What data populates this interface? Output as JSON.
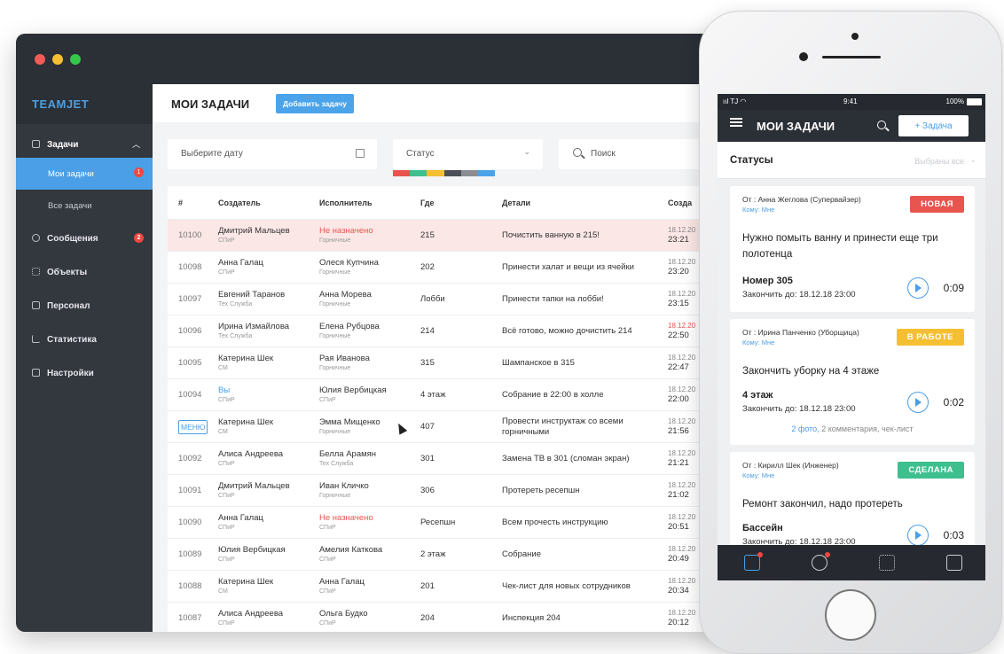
{
  "app": {
    "brand": "TEAMJET"
  },
  "sidebar": {
    "group": {
      "label": "Задачи",
      "icon": "tasks-icon"
    },
    "subitems": [
      {
        "label": "Мои задачи",
        "badge": "1"
      },
      {
        "label": "Все задачи"
      }
    ],
    "items": [
      {
        "label": "Сообщения",
        "icon": "messages-icon",
        "badge": "2"
      },
      {
        "label": "Объекты",
        "icon": "objects-icon"
      },
      {
        "label": "Персонал",
        "icon": "staff-icon"
      },
      {
        "label": "Статистика",
        "icon": "stats-icon"
      },
      {
        "label": "Настройки",
        "icon": "settings-icon"
      }
    ]
  },
  "header": {
    "title": "МОИ ЗАДАЧИ",
    "add_button": "Добавить задачу"
  },
  "filters": {
    "date_placeholder": "Выберите дату",
    "status_label": "Статус",
    "search_placeholder": "Поиск",
    "status_colors": [
      "#e8554e",
      "#3dbf8e",
      "#f5bf33",
      "#4b4f57",
      "#8a8d93",
      "#4ba3ea"
    ]
  },
  "table": {
    "columns": [
      "#",
      "Создатель",
      "Исполнитель",
      "Где",
      "Детали",
      "Созда"
    ],
    "rows": [
      {
        "id": "10100",
        "creator": "Дмитрий Мальцев",
        "creator_role": "СПиР",
        "assignee": "Не назначено",
        "assignee_role": "Горничные",
        "where": "215",
        "details": "Почистить ванную в 215!",
        "date": "18.12.20",
        "time": "23:21"
      },
      {
        "id": "10098",
        "creator": "Анна Галац",
        "creator_role": "СПиР",
        "assignee": "Олеся Купчина",
        "assignee_role": "Горничные",
        "where": "202",
        "details": "Принести халат и вещи из ячейки",
        "date": "18.12.20",
        "time": "23:20"
      },
      {
        "id": "10097",
        "creator": "Евгений Таранов",
        "creator_role": "Тех Служба",
        "assignee": "Анна Морева",
        "assignee_role": "Горничные",
        "where": "Лобби",
        "details": "Принести тапки на лобби!",
        "date": "18.12.20",
        "time": "23:15"
      },
      {
        "id": "10096",
        "creator": "Ирина Измайлова",
        "creator_role": "Тех Служба",
        "assignee": "Елена Рубцова",
        "assignee_role": "Горничные",
        "where": "214",
        "details": "Всё готово, можно дочистить 214",
        "date": "18.12.20",
        "time": "22:50"
      },
      {
        "id": "10095",
        "creator": "Катерина Шек",
        "creator_role": "СМ",
        "assignee": "Рая Иванова",
        "assignee_role": "Горничные",
        "where": "315",
        "details": "Шампанское в 315",
        "date": "18.12.20",
        "time": "22:47"
      },
      {
        "id": "10094",
        "creator": "Вы",
        "creator_role": "СПиР",
        "assignee": "Юлия Вербицкая",
        "assignee_role": "СПиР",
        "where": "4 этаж",
        "details": "Собрание в 22:00 в холле",
        "date": "18.12.20",
        "time": "22:00"
      },
      {
        "id": "МЕНЮ",
        "creator": "Катерина Шек",
        "creator_role": "СМ",
        "assignee": "Эмма Мищенко",
        "assignee_role": "Горничные",
        "where": "407",
        "details": "Провести инструктаж со всеми горничными",
        "date": "18.12.20",
        "time": "21:56"
      },
      {
        "id": "10092",
        "creator": "Алиса Андреева",
        "creator_role": "СПиР",
        "assignee": "Белла Арамян",
        "assignee_role": "Тех Служба",
        "where": "301",
        "details": "Замена ТВ в 301 (сломан экран)",
        "date": "18.12.20",
        "time": "21:21"
      },
      {
        "id": "10091",
        "creator": "Дмитрий Мальцев",
        "creator_role": "СПиР",
        "assignee": "Иван Кличко",
        "assignee_role": "Горничные",
        "where": "306",
        "details": "Протереть ресепшн",
        "date": "18.12.20",
        "time": "21:02"
      },
      {
        "id": "10090",
        "creator": "Анна Галац",
        "creator_role": "СПиР",
        "assignee": "Не назначено",
        "assignee_role": "СПиР",
        "where": "Ресепшн",
        "details": "Всем прочесть инструкцию",
        "date": "18.12.20",
        "time": "20:51"
      },
      {
        "id": "10089",
        "creator": "Юлия Вербицкая",
        "creator_role": "СПиР",
        "assignee": "Амелия Каткова",
        "assignee_role": "СПиР",
        "where": "2 этаж",
        "details": "Собрание",
        "date": "18.12.20",
        "time": "20:49"
      },
      {
        "id": "10088",
        "creator": "Катерина Шек",
        "creator_role": "СМ",
        "assignee": "Анна Галац",
        "assignee_role": "СПиР",
        "where": "201",
        "details": "Чек-лист для новых сотрудников",
        "date": "18.12.20",
        "time": "20:34"
      },
      {
        "id": "10087",
        "creator": "Алиса Андреева",
        "creator_role": "СПиР",
        "assignee": "Ольга Будко",
        "assignee_role": "СПиР",
        "where": "204",
        "details": "Инспекция 204",
        "date": "18.12.20",
        "time": "20:12"
      }
    ]
  },
  "phone": {
    "status_bar": {
      "carrier": "TJ",
      "time": "9:41",
      "battery": "100%"
    },
    "title": "МОИ ЗАДАЧИ",
    "task_button": "+ Задача",
    "statuses_label": "Статусы",
    "statuses_filter": "Выбраны все",
    "cards": [
      {
        "from": "От : Анна Жеглова (Супервайзер)",
        "to": "Кому: Мне",
        "tag": "НОВАЯ",
        "tag_color": "#e8554e",
        "body": "Нужно помыть ванну и принести еще три полотенца",
        "place": "Номер 305",
        "due": "Закончить до: 18.12.18 23:00",
        "timer": "0:09"
      },
      {
        "from": "От : Ирина Панченко (Уборщица)",
        "to": "Кому: Мне",
        "tag": "В РАБОТЕ",
        "tag_color": "#f5bf33",
        "body": "Закончить уборку на 4 этаже",
        "place": "4 этаж",
        "due": "Закончить до: 18.12.18 23:00",
        "timer": "0:02",
        "extras_link": "2 фото,",
        "extras_rest": "2 комментария, чек-лист"
      },
      {
        "from": "От : Кирилл Шек (Инженер)",
        "to": "Кому: Мне",
        "tag": "СДЕЛАНА",
        "tag_color": "#3dbf8e",
        "body": "Ремонт закончил, надо протереть",
        "place": "Бассейн",
        "due": "Закончить до: 18.12.18 23:00",
        "timer": "0:03"
      }
    ],
    "tabs": [
      "tasks-tab-icon",
      "chat-tab-icon",
      "grid-tab-icon",
      "profile-tab-icon"
    ]
  }
}
